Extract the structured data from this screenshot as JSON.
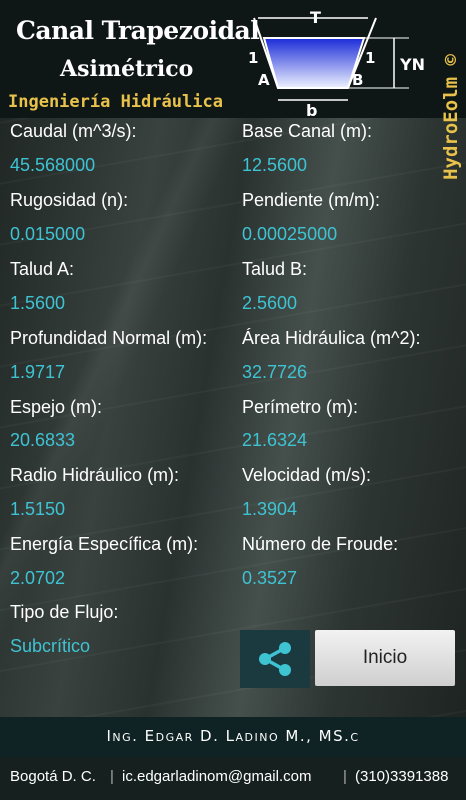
{
  "header": {
    "title": "Canal Trapezoidal",
    "subtitle_line": "Asimétrico",
    "tagline": "Ingeniería Hidráulica",
    "brand": "HydroEolm ©",
    "diagram_labels": {
      "top": "T",
      "bottom": "b",
      "left_slope": "1",
      "right_slope": "1",
      "left": "A",
      "right": "B",
      "depth": "YN"
    }
  },
  "fields": [
    {
      "label": "Caudal (m^3/s):",
      "value": "45.568000"
    },
    {
      "label": "Base Canal (m):",
      "value": "12.5600"
    },
    {
      "label": "Rugosidad (n):",
      "value": "0.015000"
    },
    {
      "label": "Pendiente (m/m):",
      "value": "0.00025000"
    },
    {
      "label": "Talud A:",
      "value": "1.5600"
    },
    {
      "label": "Talud B:",
      "value": "2.5600"
    },
    {
      "label": "Profundidad Normal (m):",
      "value": "1.9717"
    },
    {
      "label": "Área Hidráulica (m^2):",
      "value": "32.7726"
    },
    {
      "label": "Espejo (m):",
      "value": "20.6833"
    },
    {
      "label": "Perímetro (m):",
      "value": "21.6324"
    },
    {
      "label": "Radio Hidráulico (m):",
      "value": "1.5150"
    },
    {
      "label": "Velocidad (m/s):",
      "value": "1.3904"
    },
    {
      "label": "Energía Específica (m):",
      "value": "2.0702"
    },
    {
      "label": "Número de Froude:",
      "value": "0.3527"
    },
    {
      "label": "Tipo de Flujo:",
      "value": "Subcrítico"
    }
  ],
  "actions": {
    "share_icon": "share-icon",
    "inicio_label": "Inicio"
  },
  "author": "Ing. Edgar D. Ladino M., MS.c",
  "footer": {
    "city": "Bogotá D. C.",
    "email": "ic.edgarladinom@gmail.com",
    "phone": "(310)3391388"
  },
  "colors": {
    "value": "#3ec3d3",
    "tagline": "#e8c24a",
    "water": "#2233dd"
  }
}
